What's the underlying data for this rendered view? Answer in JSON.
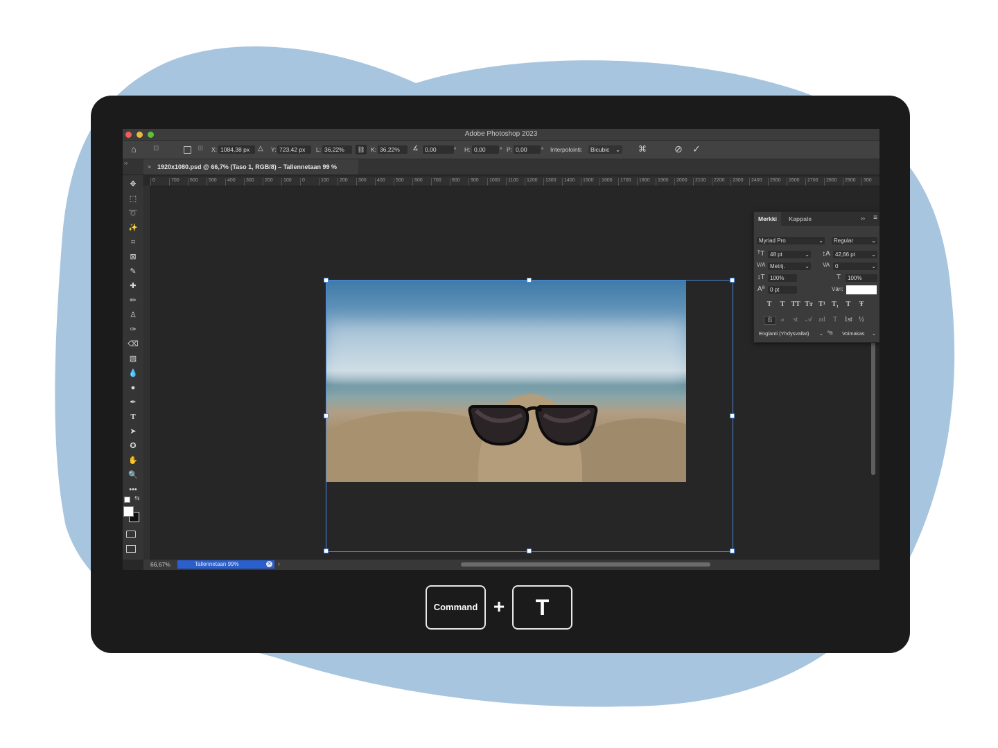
{
  "colors": {
    "blob": "#a8c5df",
    "frame": "#1b1b1b",
    "app_bg": "#282828",
    "selection_blue": "#4a8ae0",
    "progress_blue": "#2a5fd0",
    "text_color_swatch": "#ffffff"
  },
  "window": {
    "title": "Adobe Photoshop 2023"
  },
  "options_bar": {
    "x_label": "X:",
    "x_value": "1084,38 px",
    "y_label": "Y:",
    "y_value": "723,42 px",
    "w_label": "L:",
    "w_value": "36,22%",
    "h_label": "K:",
    "h_value": "36,22%",
    "angle_value": "0,00",
    "degree": "°",
    "hskew_label": "H:",
    "hskew_value": "0,00",
    "vskew_label": "P:",
    "vskew_value": "0,00",
    "interp_label": "Interpolointi:",
    "interp_value": "Bicubic",
    "icons": [
      "home-icon",
      "transform-icon",
      "reference-point-icon",
      "angle-icon",
      "link-icon",
      "warp-icon",
      "cancel-icon",
      "commit-icon"
    ]
  },
  "document": {
    "tab_title": "1920x1080.psd @ 66,7% (Taso 1, RGB/8) – Tallennetaan 99 %",
    "close": "×"
  },
  "ruler_top": [
    "0",
    "700",
    "600",
    "500",
    "400",
    "300",
    "200",
    "100",
    "0",
    "100",
    "200",
    "300",
    "400",
    "500",
    "600",
    "700",
    "800",
    "900",
    "1000",
    "1100",
    "1200",
    "1300",
    "1400",
    "1500",
    "1600",
    "1700",
    "1800",
    "1900",
    "2000",
    "2100",
    "2200",
    "2300",
    "2400",
    "2500",
    "2600",
    "2700",
    "2800",
    "2900",
    "300"
  ],
  "tools": [
    "move-tool-icon",
    "marquee-tool-icon",
    "lasso-tool-icon",
    "magic-wand-tool-icon",
    "crop-tool-icon",
    "frame-tool-icon",
    "eyedropper-tool-icon",
    "healing-tool-icon",
    "brush-tool-icon",
    "stamp-tool-icon",
    "history-brush-tool-icon",
    "eraser-tool-icon",
    "gradient-tool-icon",
    "blur-tool-icon",
    "dodge-tool-icon",
    "pen-tool-icon",
    "type-tool-icon",
    "path-select-tool-icon",
    "shape-tool-icon",
    "hand-tool-icon",
    "zoom-tool-icon",
    "more-tools-icon"
  ],
  "tool_glyphs": [
    "✥",
    "⬚",
    "➰",
    "✨",
    "⌗",
    "⊠",
    "✎",
    "✚",
    "✏",
    "♙",
    "✑",
    "⌫",
    "▧",
    "💧",
    "●",
    "✒",
    "T",
    "➤",
    "✪",
    "✋",
    "🔍",
    "•••"
  ],
  "context_bar": {
    "icons": [
      "flip-horizontal-icon",
      "warp-vertical-icon",
      "more-options-icon",
      "cancel-icon",
      "commit-icon"
    ],
    "glyphs": [
      "⧓",
      "⧖",
      "···",
      "⊘",
      "✓"
    ]
  },
  "status": {
    "zoom": "66,67%",
    "progress_label": "Tallennetaan 99%",
    "progress": 0.99
  },
  "character_panel": {
    "tab_active": "Merkki",
    "tab_other": "Kappale",
    "collapse": "››",
    "font_family": "Myriad Pro",
    "font_style": "Regular",
    "font_size": "48 pt",
    "leading": "42,66 pt",
    "kerning": "Metrij.",
    "tracking": "0",
    "vertical_scale": "100%",
    "horizontal_scale": "100%",
    "baseline_shift": "0 pt",
    "color_label": "Väri:",
    "style_buttons": [
      "T",
      "T",
      "TT",
      "Tт",
      "T¹",
      "T₁",
      "T",
      "Ŧ"
    ],
    "opentype_buttons": [
      "fi",
      "ℴ",
      "st",
      "𝒜",
      "ad",
      "T",
      "1st",
      "½"
    ],
    "language": "Englanti (Yhdysvallat)",
    "aa_label": "ªa",
    "antialias": "Voimakas"
  },
  "shortcut": {
    "key1": "Command",
    "plus": "+",
    "key2": "T"
  }
}
